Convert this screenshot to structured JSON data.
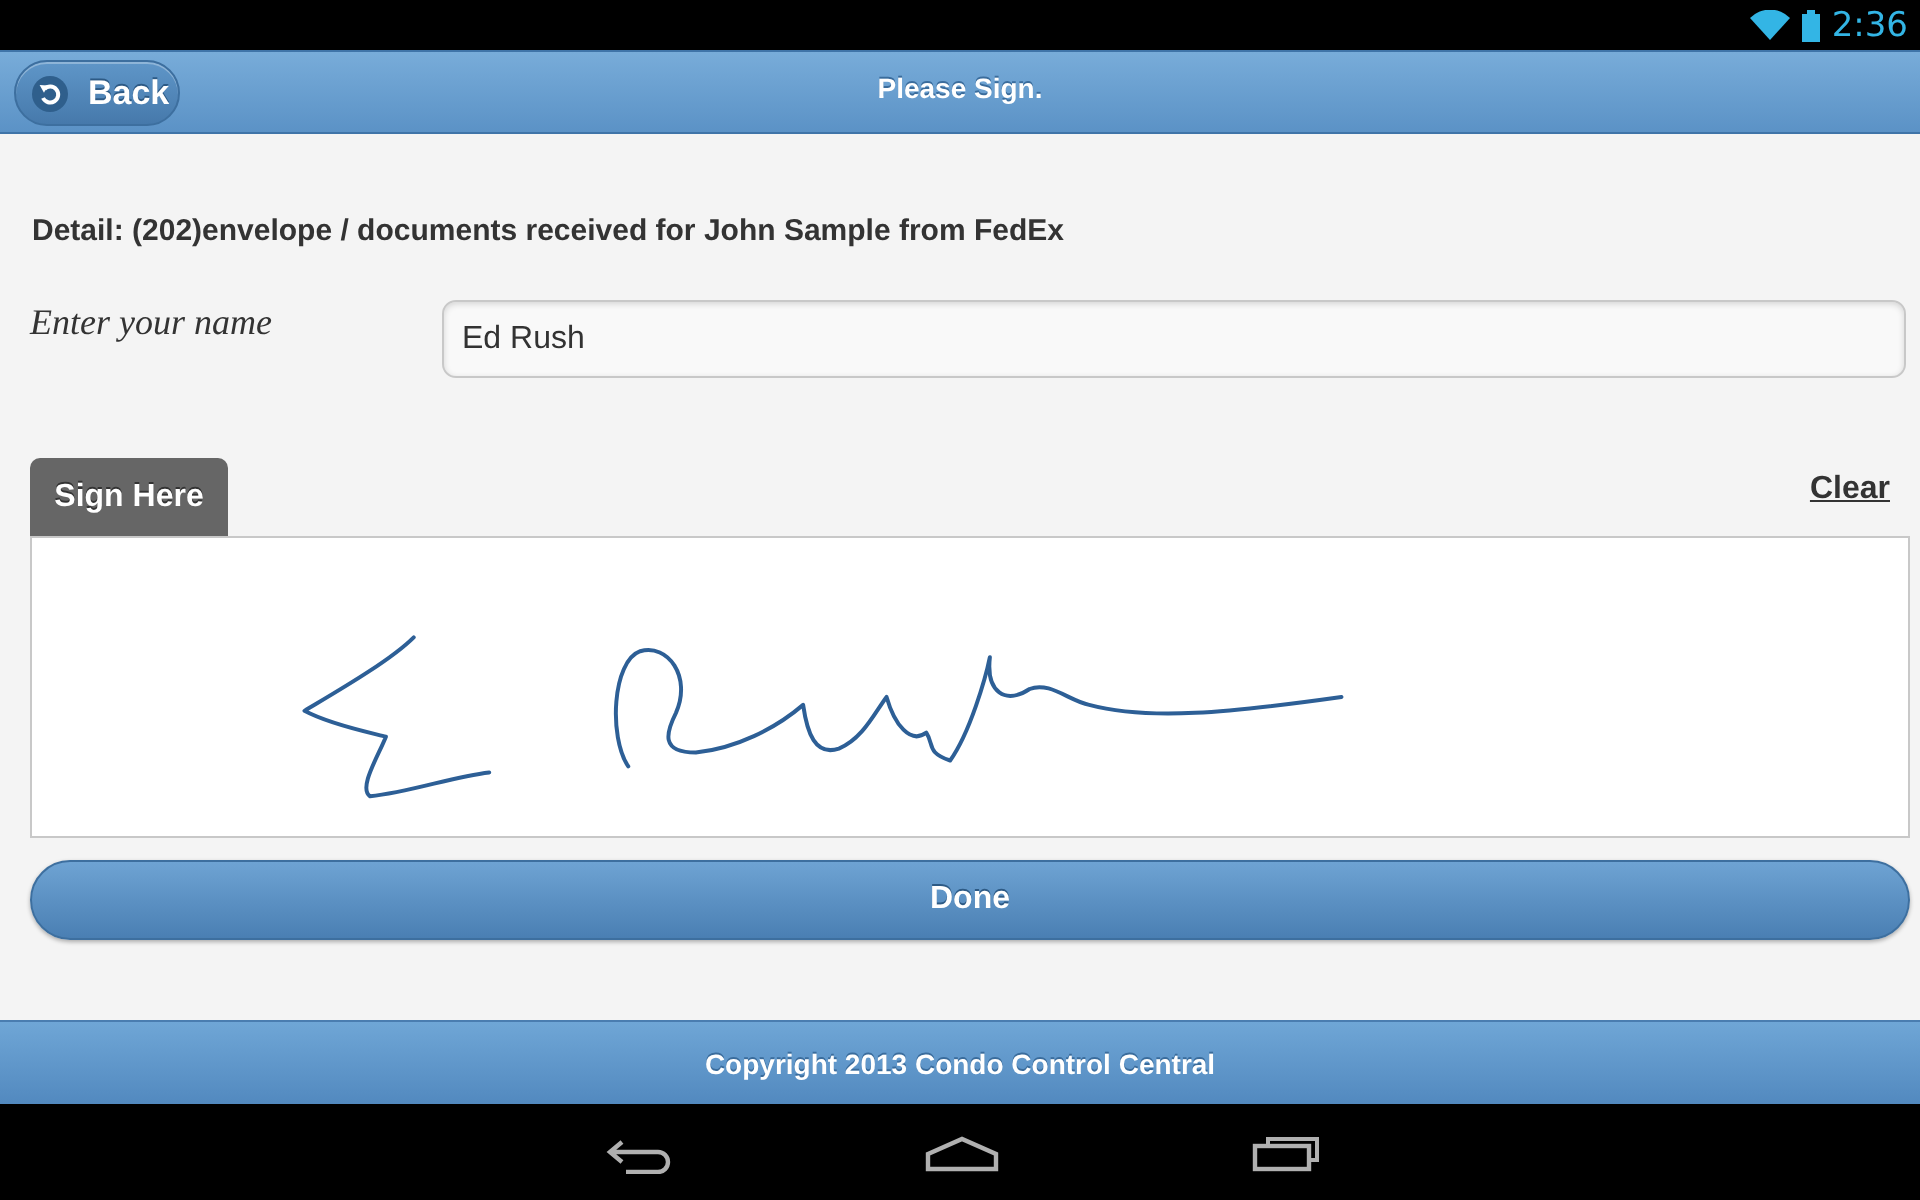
{
  "status_bar": {
    "time": "2:36"
  },
  "header": {
    "back_button": "Back",
    "title": "Please Sign."
  },
  "detail": "Detail: (202)envelope / documents received for John Sample from FedEx",
  "name_field": {
    "label": "Enter your name",
    "value": "Ed Rush"
  },
  "signature_pad": {
    "tab": "Sign Here",
    "clear_link": "Clear"
  },
  "done_button": "Done",
  "footer": {
    "copyright": "Copyright 2013 Condo Control Central"
  }
}
